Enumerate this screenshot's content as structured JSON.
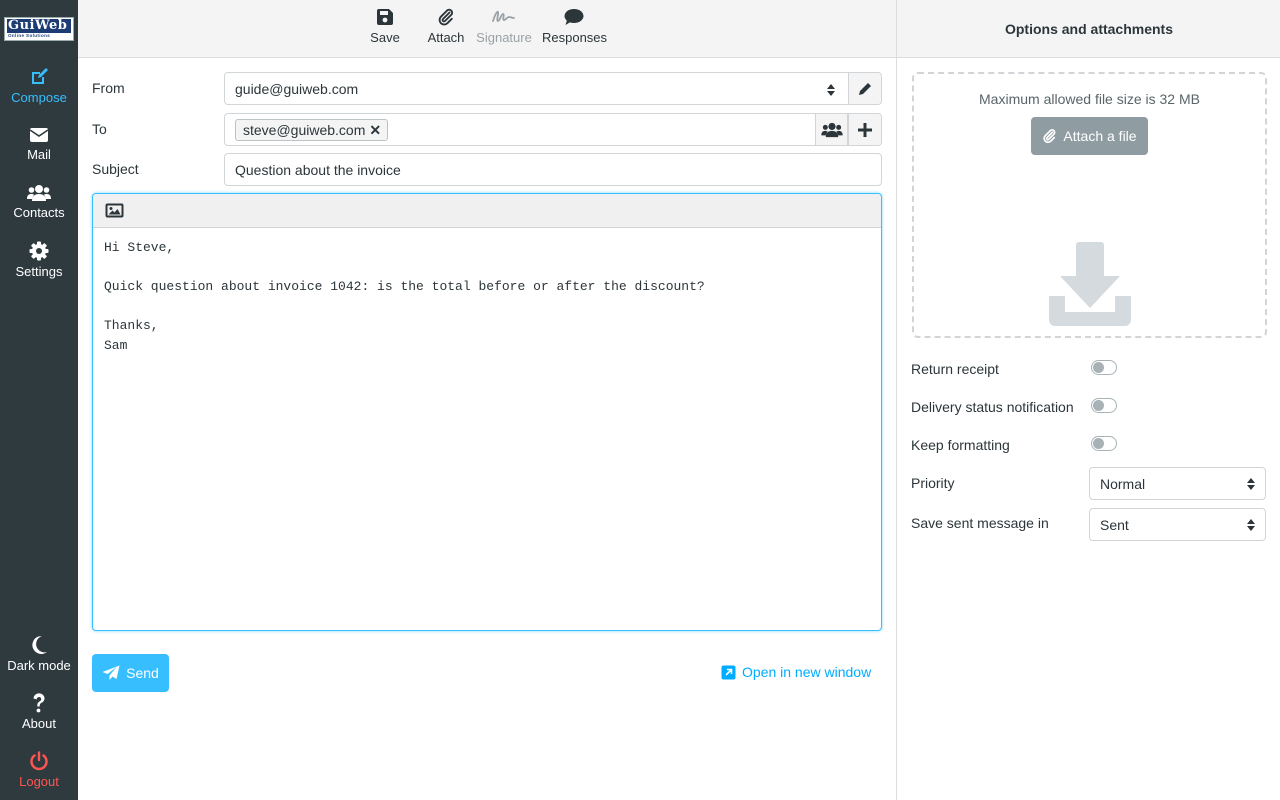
{
  "logo": {
    "main": "GuiWeb",
    "tagline": "Online Solutions"
  },
  "nav": {
    "compose": "Compose",
    "mail": "Mail",
    "contacts": "Contacts",
    "settings": "Settings",
    "dark_mode": "Dark mode",
    "about": "About",
    "logout": "Logout"
  },
  "toolbar": {
    "save": "Save",
    "attach": "Attach",
    "signature": "Signature",
    "responses": "Responses"
  },
  "form": {
    "from_label": "From",
    "from_value": "guide@guiweb.com",
    "to_label": "To",
    "to_recipients": [
      "steve@guiweb.com"
    ],
    "subject_label": "Subject",
    "subject_value": "Question about the invoice",
    "body": "Hi Steve,\n\nQuick question about invoice 1042: is the total before or after the discount?\n\nThanks,\nSam"
  },
  "actions": {
    "send": "Send",
    "open_new_window": "Open in new window"
  },
  "panel": {
    "title": "Options and attachments",
    "max_size": "Maximum allowed file size is 32 MB",
    "attach_button": "Attach a file",
    "options": {
      "return_receipt": "Return receipt",
      "delivery_status": "Delivery status notification",
      "keep_formatting": "Keep formatting",
      "priority_label": "Priority",
      "priority_value": "Normal",
      "save_sent_label": "Save sent message in",
      "save_sent_value": "Sent"
    },
    "toggles": {
      "return_receipt": false,
      "delivery_status": false,
      "keep_formatting": false
    }
  },
  "colors": {
    "accent": "#37beff",
    "sidebar": "#2f3a3f",
    "logout": "#ff5552",
    "link": "#00acff"
  }
}
